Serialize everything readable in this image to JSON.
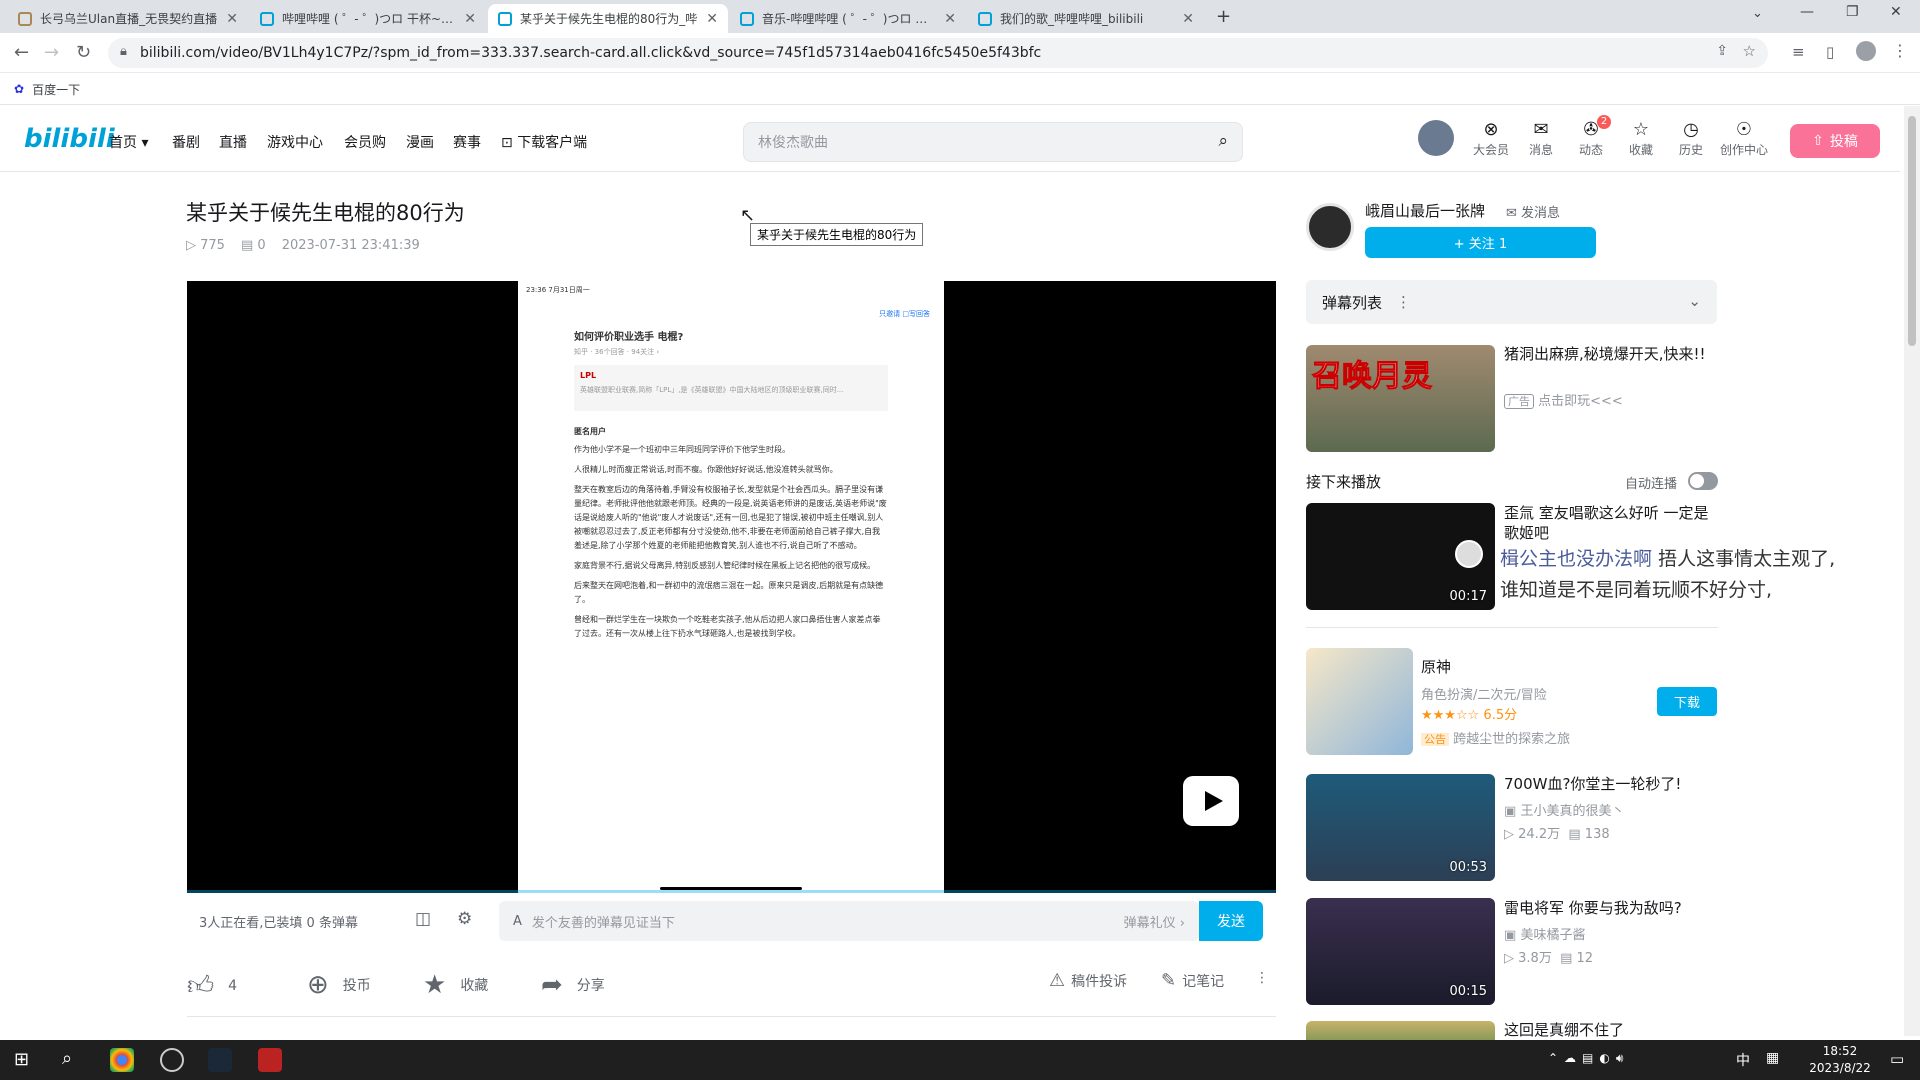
{
  "browser": {
    "tabs": [
      {
        "title": "长弓乌兰Ulan直播_无畏契约直播",
        "active": false
      },
      {
        "title": "哔哩哔哩 ( ゜- ゜)つロ 干杯~-bili",
        "active": false
      },
      {
        "title": "某乎关于候先生电棍的80行为_哔",
        "active": true
      },
      {
        "title": "音乐-哔哩哔哩 ( ゜- ゜)つロ 干杯",
        "active": false
      },
      {
        "title": "我们的歌_哔哩哔哩_bilibili",
        "active": false
      }
    ],
    "url": "bilibili.com/video/BV1Lh4y1C7Pz/?spm_id_from=333.337.search-card.all.click&vd_source=745f1d57314aeb0416fc5450e5f43bfc",
    "bookmark": "百度一下"
  },
  "header": {
    "logo": "bilibili",
    "nav": [
      "首页",
      "番剧",
      "直播",
      "游戏中心",
      "会员购",
      "漫画",
      "赛事",
      "下载客户端"
    ],
    "search_placeholder": "林俊杰歌曲",
    "icons": [
      {
        "label": "大会员",
        "icon": "vip-icon"
      },
      {
        "label": "消息",
        "icon": "message-icon"
      },
      {
        "label": "动态",
        "icon": "dynamic-icon",
        "badge": "2"
      },
      {
        "label": "收藏",
        "icon": "star-icon"
      },
      {
        "label": "历史",
        "icon": "history-icon"
      },
      {
        "label": "创作中心",
        "icon": "bulb-icon"
      }
    ],
    "upload": "投稿"
  },
  "video": {
    "title": "某乎关于候先生电棍的80行为",
    "views": "775",
    "danmaku": "0",
    "date": "2023-07-31 23:41:39",
    "tooltip": "某乎关于候先生电棍的80行为",
    "screen": {
      "status": "23:36 7月31日周一",
      "question": "如何评价职业选手 电棍?",
      "qmeta": "知乎 · 36个回答 · 94关注 ›",
      "card_title": "LPL",
      "card_desc": "英雄联盟职业联赛,简称「LPL」,是《英雄联盟》中国大陆地区的顶级职业联赛,同时...",
      "author": "匿名用户",
      "p1": "作为他小学不是一个班初中三年同班同学评价下他学生时段。",
      "p2": "人很精儿,时而瘦正常说话,时而不瘦。你跟他好好说话,他没准转头就骂你。",
      "p3": "整天在教室后边的角落待着,手臂没有校服袖子长,发型就是个社会西瓜头。膈子里没有谦量纪律。老师批评他他就跟老师顶。经典的一段是,说英语老师讲的是废话,英语老师说\"废话是说给废人听的\"他说\"废人才说废话\",还有一回,也是犯了错误,被初中班主任嘲讽,别人被嘲就忍忍过去了,反正老师都有分寸没使劲,他不,非要在老师面前给自己裤子撑大,自我羞述是,除了小学那个姓夏的老师能把他教育笑,别人谁也不行,说自己听了不感动。",
      "p4": "家庭背景不行,据说父母离异,特别反感别人管纪律时候在黑板上记名把他的很写成候。",
      "p5": "后来整天在网吧泡着,和一群初中的流氓痞三混在一起。原来只是调皮,后期就是有点缺德了。",
      "p6": "曾经和一群烂学生在一块欺负一个吃鞋老实孩子,他从后边把人家口鼻捂住害人家差点拳了过去。还有一次从楼上往下扔水气球砸路人,也是被找到学校。",
      "actions": "只邀请 □写回答"
    }
  },
  "danmaku_bar": {
    "status": "3人正在看,已装填 0 条弹幕",
    "placeholder": "发个友善的弹幕见证当下",
    "etiquette": "弹幕礼仪 ›",
    "send": "发送"
  },
  "toolbar": {
    "like_count": "4",
    "coin": "投币",
    "fav": "收藏",
    "share": "分享",
    "report": "稿件投诉",
    "notes": "记笔记"
  },
  "uploader": {
    "name": "峨眉山最后一张牌",
    "message": "发消息",
    "follow": "+ 关注 1"
  },
  "danmaku_list": {
    "label": "弹幕列表"
  },
  "ad": {
    "title": "猪洞出麻痹,秘境爆开天,快来!!",
    "badge": "广告",
    "cta": "点击即玩<<<",
    "thumb_text": "召唤月灵"
  },
  "next_up": {
    "label": "接下来播放",
    "autoplay": "自动连播"
  },
  "recommendations": [
    {
      "title": "歪氚 室友唱歌这么好听 一定是歌姬吧",
      "duration": "00:17"
    },
    {
      "title": "700W血?你堂主一轮秒了!",
      "author": "王小美真的很美丶",
      "views": "24.2万",
      "danmaku": "138",
      "duration": "00:53"
    },
    {
      "title": "雷电将军 你要与我为敌吗?",
      "author": "美味橘子酱",
      "views": "3.8万",
      "danmaku": "12",
      "duration": "00:15"
    },
    {
      "title": "这回是真绷不住了"
    }
  ],
  "overlay_danmaku": {
    "line1": "楫公主也没办法啊",
    "line2": "捂人这事情太主观了,",
    "line3": "谁知道是不是同着玩顺不好分寸,"
  },
  "game": {
    "name": "原神",
    "genre": "角色扮演/二次元/冒险",
    "rating": "6.5分",
    "notice_badge": "公告",
    "notice": "跨越尘世的探索之旅",
    "download": "下载"
  },
  "taskbar": {
    "time": "18:52",
    "date": "2023/8/22",
    "ime": "中"
  }
}
